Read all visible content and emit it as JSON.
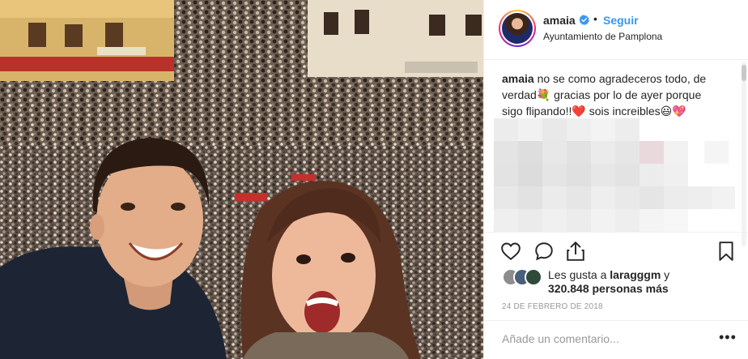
{
  "post": {
    "username": "amaia",
    "dot": "•",
    "follow_label": "Seguir",
    "location": "Ayuntamiento de Pamplona",
    "caption_user": "amaia",
    "caption_text": " no se como agradeceros todo, de verdad💐 gracias por lo de ayer porque sigo flipando!!❤️ sois increibles😃💖",
    "likes_prefix": "Les gusta a ",
    "likes_user": "laragggm",
    "likes_suffix": " y",
    "likes_count": "320.848 personas más",
    "date": "24 DE FEBRERO DE 2018",
    "comment_placeholder": "Añade un comentario...",
    "more_label": "•••"
  },
  "icons": {
    "verified": "verified-badge-icon",
    "like": "heart-icon",
    "comment": "comment-bubble-icon",
    "share": "share-icon",
    "save": "bookmark-icon",
    "more": "more-dots-icon"
  },
  "colors": {
    "accent": "#3897f0",
    "text": "#262626",
    "muted": "#999999",
    "border": "#efefef"
  }
}
